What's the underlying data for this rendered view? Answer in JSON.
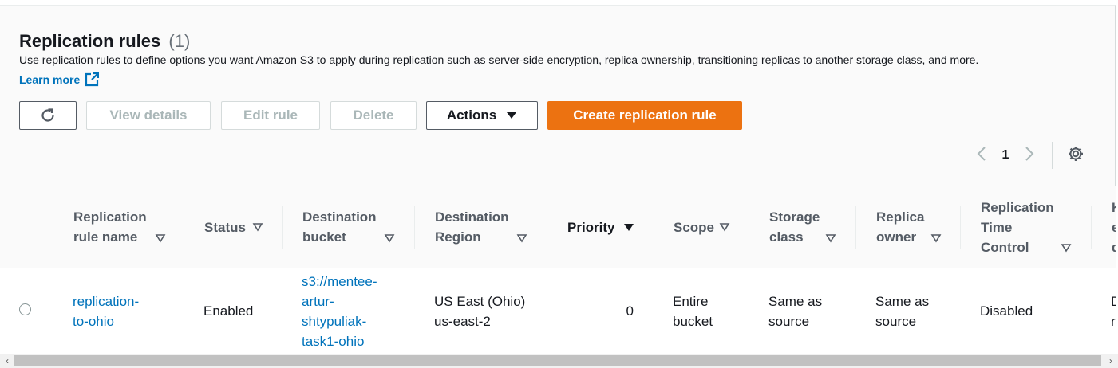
{
  "header": {
    "title": "Replication rules",
    "count": "(1)",
    "description": "Use replication rules to define options you want Amazon S3 to apply during replication such as server-side encryption, replica ownership, transitioning replicas to another storage class, and more.",
    "learn_more": "Learn more"
  },
  "toolbar": {
    "view_details": "View details",
    "edit_rule": "Edit rule",
    "delete": "Delete",
    "actions": "Actions",
    "create": "Create replication rule"
  },
  "pagination": {
    "page": "1"
  },
  "table": {
    "columns": {
      "name_l1": "Replication",
      "name_l2": "rule name",
      "status": "Status",
      "dest_bucket_l1": "Destination",
      "dest_bucket_l2": "bucket",
      "dest_region_l1": "Destination",
      "dest_region_l2": "Region",
      "priority": "Priority",
      "scope": "Scope",
      "storage_l1": "Storage",
      "storage_l2": "class",
      "owner_l1": "Replica",
      "owner_l2": "owner",
      "rtc_l1": "Replication",
      "rtc_l2": "Time",
      "rtc_l3": "Control",
      "next_l1": "K",
      "next_l2": "e",
      "next_l3": "d"
    },
    "row": {
      "name_l1": "replication-",
      "name_l2": "to-ohio",
      "status": "Enabled",
      "bucket_l1": "s3://mentee-",
      "bucket_l2": "artur-",
      "bucket_l3": "shtypuliak-",
      "bucket_l4": "task1-ohio",
      "region_l1": "US East (Ohio)",
      "region_l2": "us-east-2",
      "priority": "0",
      "scope_l1": "Entire",
      "scope_l2": "bucket",
      "storage_l1": "Same as",
      "storage_l2": "source",
      "owner_l1": "Same as",
      "owner_l2": "source",
      "rtc": "Disabled",
      "next_l1": "D",
      "next_l2": "r"
    }
  },
  "colors": {
    "accent": "#0073bb",
    "primary_button": "#ec7211"
  }
}
